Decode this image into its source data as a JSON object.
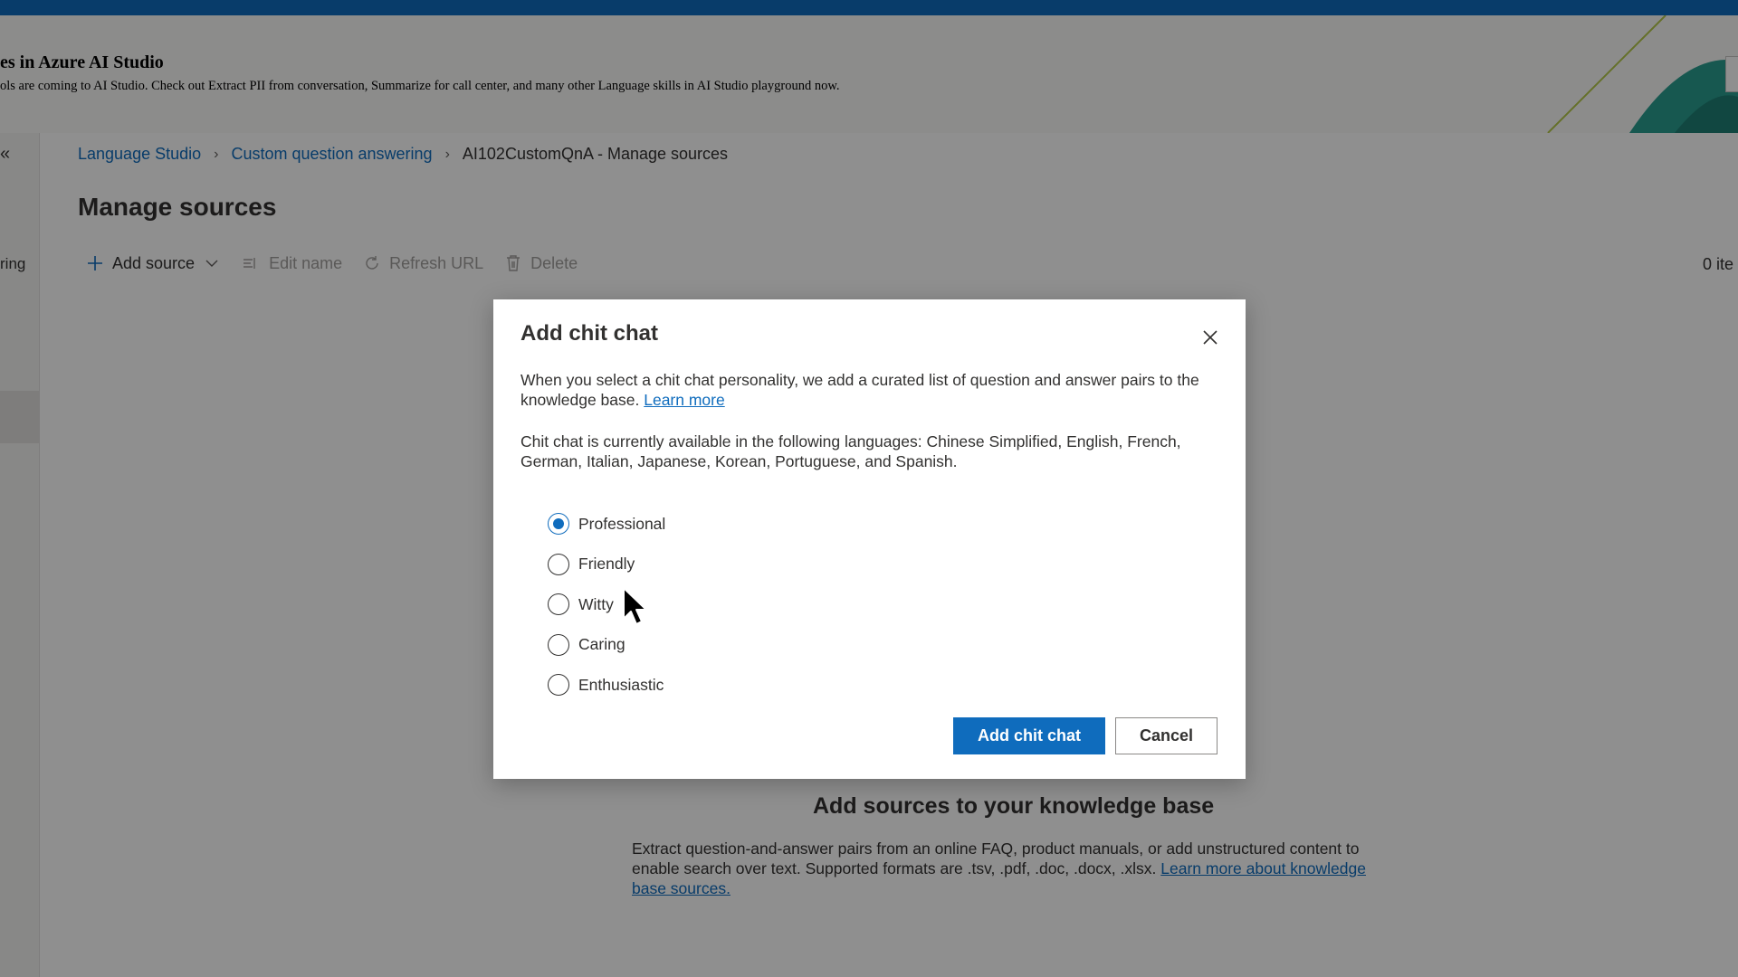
{
  "banner": {
    "title": "es in Azure AI Studio",
    "text": "ols are coming to AI Studio. Check out Extract PII from conversation, Summarize for call center, and many other Language skills in AI Studio playground now."
  },
  "sidebar": {
    "collapse_icon": "«",
    "partial_label": "ring"
  },
  "breadcrumb": {
    "items": [
      "Language Studio",
      "Custom question answering"
    ],
    "current": "AI102CustomQnA - Manage sources",
    "separator": "›"
  },
  "page": {
    "title": "Manage sources"
  },
  "toolbar": {
    "add_source": "Add source",
    "edit_name": "Edit name",
    "refresh_url": "Refresh URL",
    "delete": "Delete",
    "item_count": "0 ite"
  },
  "empty_state": {
    "title": "Add sources to your knowledge base",
    "text": "Extract question-and-answer pairs from an online FAQ, product manuals, or add unstructured content to enable search over text. Supported formats are .tsv, .pdf, .doc, .docx, .xlsx.",
    "link": "Learn more about knowledge base sources."
  },
  "dialog": {
    "title": "Add chit chat",
    "close_icon": "close-icon",
    "description": "When you select a chit chat personality, we add a curated list of question and answer pairs to the knowledge base.",
    "learn_more": "Learn more",
    "languages_note": "Chit chat is currently available in the following languages: Chinese Simplified, English, French, German, Italian, Japanese, Korean, Portuguese, and Spanish.",
    "options": [
      "Professional",
      "Friendly",
      "Witty",
      "Caring",
      "Enthusiastic"
    ],
    "selected": "Professional",
    "primary_button": "Add chit chat",
    "secondary_button": "Cancel"
  },
  "colors": {
    "accent": "#0f6cbd",
    "text": "#323130",
    "disabled": "#a19f9d"
  }
}
